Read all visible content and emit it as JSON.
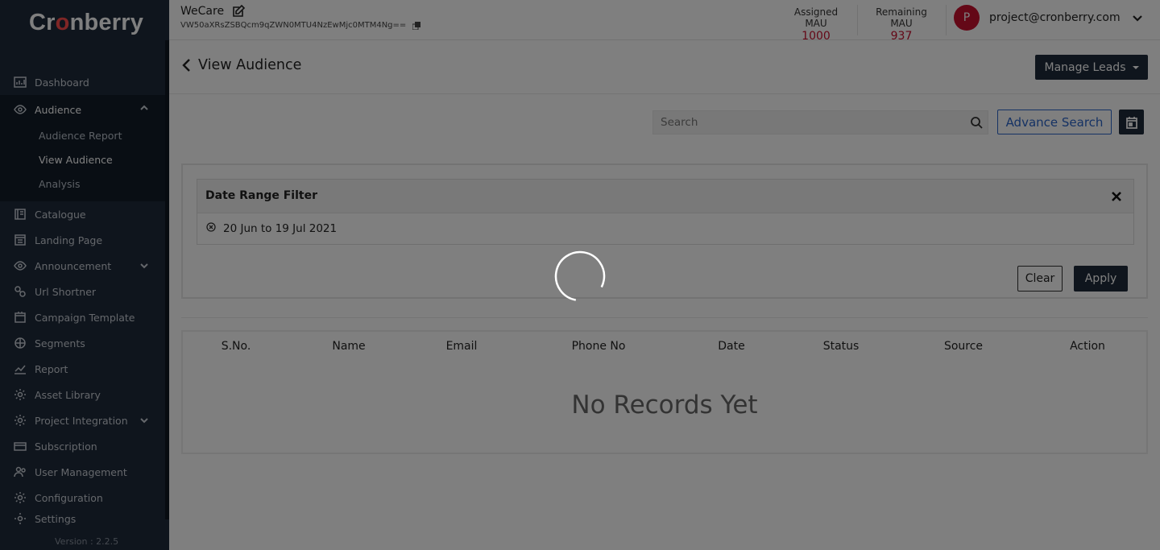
{
  "brand": {
    "logo_prefix": "Cr",
    "logo_o": "o",
    "logo_suffix": "nberry"
  },
  "sidebar": {
    "items": [
      {
        "label": "Dashboard",
        "icon": "chart-icon"
      },
      {
        "label": "Audience",
        "icon": "eye-icon",
        "expanded": true
      },
      {
        "label": "Catalogue",
        "icon": "book-icon"
      },
      {
        "label": "Landing Page",
        "icon": "page-icon"
      },
      {
        "label": "Announcement",
        "icon": "eye-icon"
      },
      {
        "label": "Url Shortner",
        "icon": "link-icon"
      },
      {
        "label": "Campaign Template",
        "icon": "template-icon"
      },
      {
        "label": "Segments",
        "icon": "segments-icon"
      },
      {
        "label": "Report",
        "icon": "trend-icon"
      },
      {
        "label": "Asset Library",
        "icon": "gear-icon"
      },
      {
        "label": "Project Integration",
        "icon": "gear-icon"
      },
      {
        "label": "Subscription",
        "icon": "card-icon"
      },
      {
        "label": "User Management",
        "icon": "users-icon"
      },
      {
        "label": "Configuration",
        "icon": "gear-icon"
      },
      {
        "label": "Settings",
        "icon": "gear-icon"
      }
    ],
    "audience_sub": [
      "Audience Report",
      "View Audience",
      "Analysis"
    ],
    "version": "Version : 2.2.5"
  },
  "topbar": {
    "project_name": "WeCare",
    "project_key": "VW50aXRsZSBQcm9qZWN0MTU4NzEwMjc0MTM4Ng==",
    "assigned_label": "Assigned MAU",
    "assigned_value": "1000",
    "remaining_label": "Remaining MAU",
    "remaining_value": "937",
    "avatar_letter": "P",
    "user_email": "project@cronberry.com"
  },
  "page": {
    "title": "View Audience",
    "manage_leads": "Manage Leads",
    "search_placeholder": "Search",
    "advance_search": "Advance Search"
  },
  "filter": {
    "title": "Date Range Filter",
    "chip": "20 Jun to 19 Jul 2021",
    "clear": "Clear",
    "apply": "Apply"
  },
  "table": {
    "columns": [
      "S.No.",
      "Name",
      "Email",
      "Phone No",
      "Date",
      "Status",
      "Source",
      "Action"
    ],
    "empty": "No Records Yet"
  },
  "colors": {
    "accent": "#c8102e",
    "dark": "#1e2a3a",
    "link": "#2b64c9"
  }
}
